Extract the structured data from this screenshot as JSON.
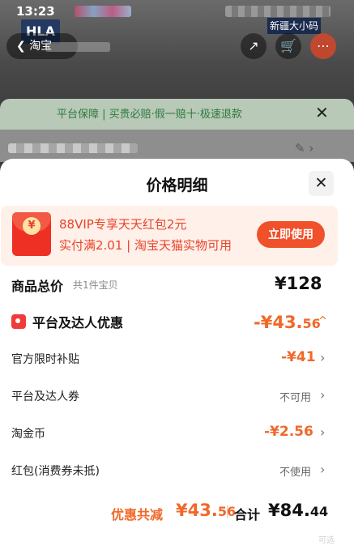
{
  "status_bar": {
    "time": "13:23"
  },
  "bg": {
    "logo": "HLA",
    "back_icon": "back-arrow-icon",
    "back_text": "淘宝",
    "promo": "新疆大小码",
    "share_icon": "share-icon",
    "cart_icon": "cart-icon",
    "more_icon": "more-icon",
    "guarantee": "平台保障 | 买贵必赔·假一赔十·极速退款",
    "guarantee_close": "✕"
  },
  "sheet": {
    "title": "价格明细",
    "close": "✕",
    "vip": {
      "line1": "88VIP专享天天红包2元",
      "line2": "实付满2.01 | 淘宝天猫实物可用",
      "button": "立即使用",
      "icon": "red-envelope-icon",
      "coin": "¥"
    },
    "total": {
      "label": "商品总价",
      "sub": "共1件宝贝",
      "price": "¥128"
    },
    "discount": {
      "label": "平台及达人优惠",
      "price_main": "-¥43.",
      "price_decimal": "56",
      "caret": "^",
      "icon": "tag-icon"
    },
    "rows": [
      {
        "label": "官方限时补贴",
        "value": "-¥41"
      },
      {
        "label": "平台及达人券",
        "value": "不可用"
      },
      {
        "label": "淘金币",
        "value": "-¥2.56"
      },
      {
        "label": "红包(消费券未抵)",
        "value": "不使用"
      }
    ],
    "chevron": "›",
    "summary": {
      "discount_label": "优惠共减",
      "discount_main": "¥43.",
      "discount_decimal": "56",
      "total_label": "合计",
      "total_main": "¥84.",
      "total_decimal": "44"
    }
  },
  "watermark": "可选",
  "colors": {
    "accent": "#f0682a",
    "vip_red": "#e8442a",
    "guarantee_green": "#2d7a3c"
  }
}
